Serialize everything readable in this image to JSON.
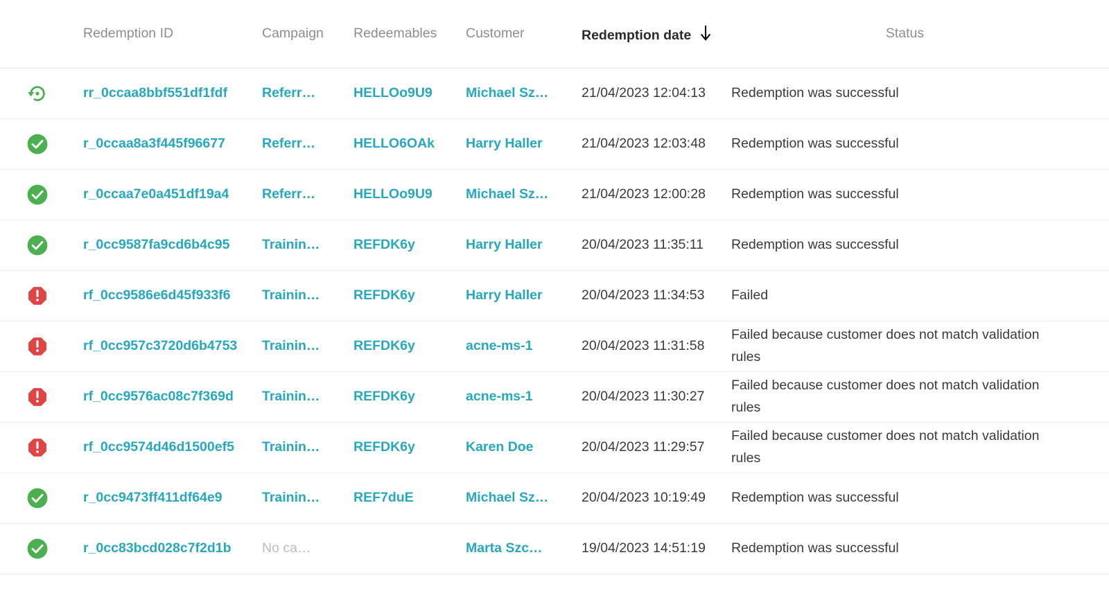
{
  "table": {
    "columns": [
      {
        "key": "status_icon",
        "label": "",
        "align": "left"
      },
      {
        "key": "redemption_id",
        "label": "Redemption ID",
        "align": "left"
      },
      {
        "key": "campaign",
        "label": "Campaign",
        "align": "left"
      },
      {
        "key": "redeemables",
        "label": "Redeemables",
        "align": "left"
      },
      {
        "key": "customer",
        "label": "Customer",
        "align": "left"
      },
      {
        "key": "redemption_date",
        "label": "Redemption date",
        "align": "left",
        "sorted": "desc",
        "sort_icon": "arrow-down-icon"
      },
      {
        "key": "status",
        "label": "Status",
        "align": "center"
      }
    ],
    "header": {
      "redemption_id": "Redemption ID",
      "campaign": "Campaign",
      "redeemables": "Redeemables",
      "customer": "Customer",
      "redemption_date": "Redemption date",
      "status": "Status"
    },
    "rows": [
      {
        "icon": "rollback-icon",
        "icon_color": "#4caf50",
        "redemption_id": "rr_0ccaa8bbf551df1fdf",
        "campaign": "Referr…",
        "campaign_muted": false,
        "redeemables": "HELLOo9U9",
        "customer": "Michael Sz…",
        "redemption_date": "21/04/2023 12:04:13",
        "status": "Redemption was successful"
      },
      {
        "icon": "check-circle-icon",
        "icon_color": "#4caf50",
        "redemption_id": "r_0ccaa8a3f445f96677",
        "campaign": "Referr…",
        "campaign_muted": false,
        "redeemables": "HELLO6OAk",
        "customer": "Harry Haller",
        "redemption_date": "21/04/2023 12:03:48",
        "status": "Redemption was successful"
      },
      {
        "icon": "check-circle-icon",
        "icon_color": "#4caf50",
        "redemption_id": "r_0ccaa7e0a451df19a4",
        "campaign": "Referr…",
        "campaign_muted": false,
        "redeemables": "HELLOo9U9",
        "customer": "Michael Sz…",
        "redemption_date": "21/04/2023 12:00:28",
        "status": "Redemption was successful"
      },
      {
        "icon": "check-circle-icon",
        "icon_color": "#4caf50",
        "redemption_id": "r_0cc9587fa9cd6b4c95",
        "campaign": "Trainin…",
        "campaign_muted": false,
        "redeemables": "REFDK6y",
        "customer": "Harry Haller",
        "redemption_date": "20/04/2023 11:35:11",
        "status": "Redemption was successful"
      },
      {
        "icon": "error-octagon-icon",
        "icon_color": "#e04545",
        "redemption_id": "rf_0cc9586e6d45f933f6",
        "campaign": "Trainin…",
        "campaign_muted": false,
        "redeemables": "REFDK6y",
        "customer": "Harry Haller",
        "redemption_date": "20/04/2023 11:34:53",
        "status": "Failed"
      },
      {
        "icon": "error-octagon-icon",
        "icon_color": "#e04545",
        "redemption_id": "rf_0cc957c3720d6b4753",
        "campaign": "Trainin…",
        "campaign_muted": false,
        "redeemables": "REFDK6y",
        "customer": "acne-ms-1",
        "redemption_date": "20/04/2023 11:31:58",
        "status": "Failed because customer does not match validation rules"
      },
      {
        "icon": "error-octagon-icon",
        "icon_color": "#e04545",
        "redemption_id": "rf_0cc9576ac08c7f369d",
        "campaign": "Trainin…",
        "campaign_muted": false,
        "redeemables": "REFDK6y",
        "customer": "acne-ms-1",
        "redemption_date": "20/04/2023 11:30:27",
        "status": "Failed because customer does not match validation rules"
      },
      {
        "icon": "error-octagon-icon",
        "icon_color": "#e04545",
        "redemption_id": "rf_0cc9574d46d1500ef5",
        "campaign": "Trainin…",
        "campaign_muted": false,
        "redeemables": "REFDK6y",
        "customer": "Karen Doe",
        "redemption_date": "20/04/2023 11:29:57",
        "status": "Failed because customer does not match validation rules"
      },
      {
        "icon": "check-circle-icon",
        "icon_color": "#4caf50",
        "redemption_id": "r_0cc9473ff411df64e9",
        "campaign": "Trainin…",
        "campaign_muted": false,
        "redeemables": "REF7duE",
        "customer": "Michael Sz…",
        "redemption_date": "20/04/2023 10:19:49",
        "status": "Redemption was successful"
      },
      {
        "icon": "check-circle-icon",
        "icon_color": "#4caf50",
        "redemption_id": "r_0cc83bcd028c7f2d1b",
        "campaign": "No ca…",
        "campaign_muted": true,
        "redeemables": "",
        "customer": "Marta Szc…",
        "redemption_date": "19/04/2023 14:51:19",
        "status": "Redemption was successful"
      }
    ]
  },
  "colors": {
    "link": "#26a8bd",
    "success": "#4caf50",
    "error": "#e04545",
    "header_muted": "#8e8e8e",
    "header_active": "#2b2b2b",
    "body_text": "#3a3a3a",
    "muted_text": "#bcbcbc",
    "row_border": "#eeeeee",
    "background": "#ffffff"
  }
}
